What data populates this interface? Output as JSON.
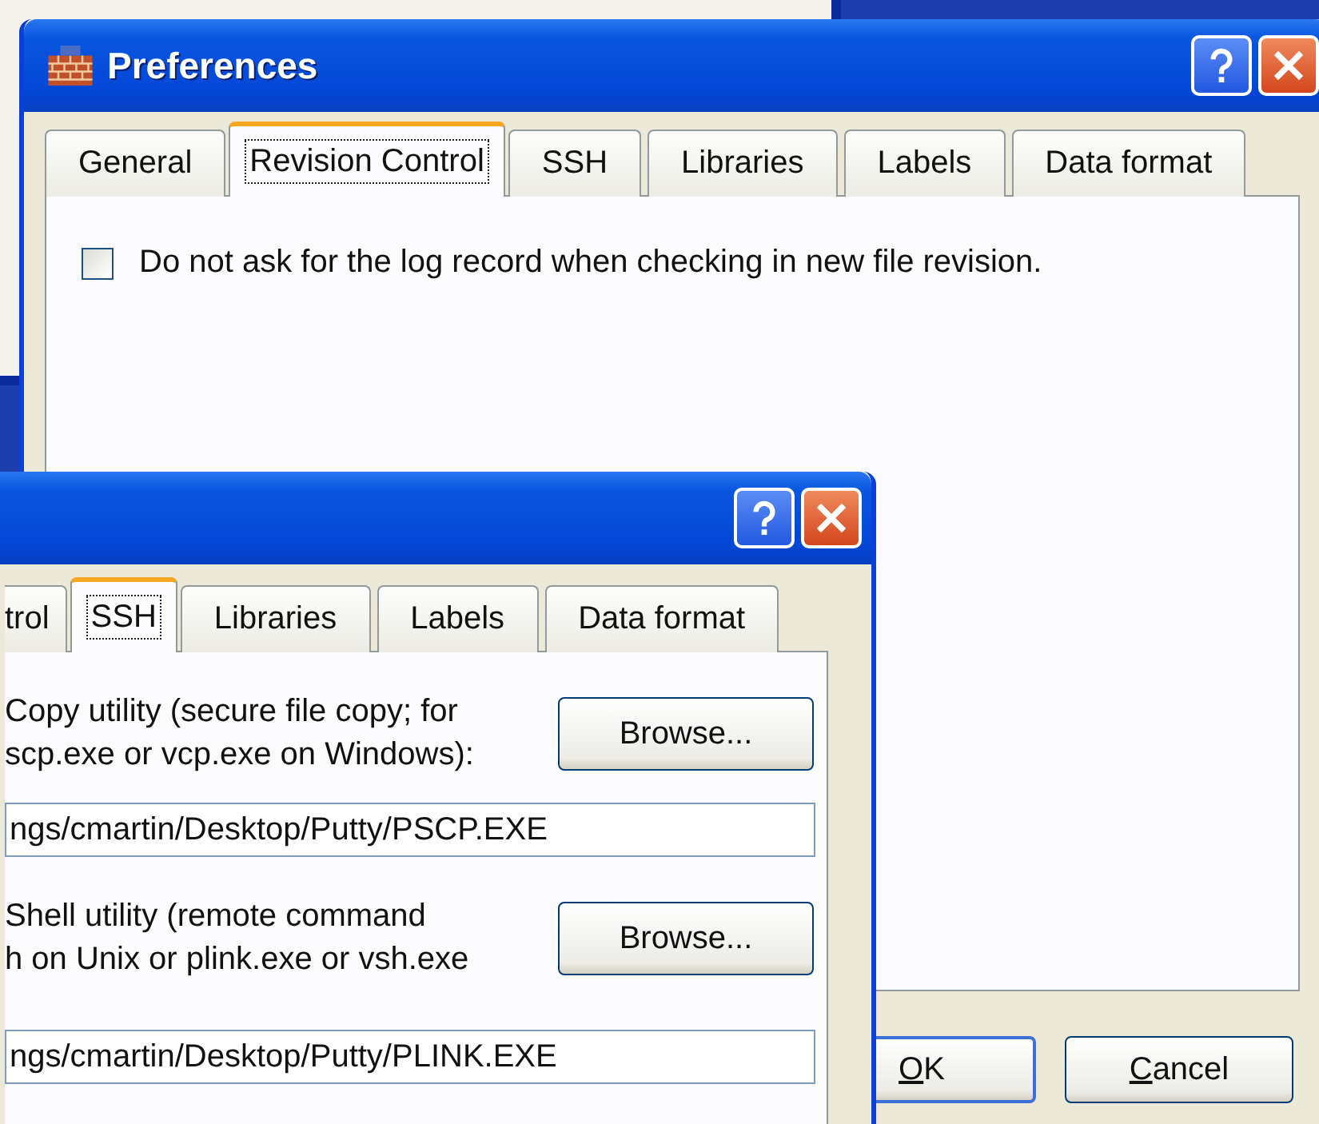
{
  "back_window": {
    "title": "Preferences",
    "tabs": [
      {
        "label": "General",
        "selected": false
      },
      {
        "label": "Revision Control",
        "selected": true
      },
      {
        "label": "SSH",
        "selected": false
      },
      {
        "label": "Libraries",
        "selected": false
      },
      {
        "label": "Labels",
        "selected": false
      },
      {
        "label": "Data format",
        "selected": false
      }
    ],
    "checkbox": {
      "label": "Do not ask for the log record when checking in new file revision.",
      "checked": false
    },
    "buttons": [
      {
        "label": "OK",
        "kind": "default"
      },
      {
        "label": "Cancel",
        "kind": "normal"
      }
    ]
  },
  "front_window": {
    "tabs": [
      {
        "label": "trol",
        "selected": false
      },
      {
        "label": "SSH",
        "selected": true
      },
      {
        "label": "Libraries",
        "selected": false
      },
      {
        "label": "Labels",
        "selected": false
      },
      {
        "label": "Data format",
        "selected": false
      }
    ],
    "settings": [
      {
        "label": "Copy utility (secure file copy; for\nscp.exe or vcp.exe on Windows):",
        "button": "Browse...",
        "value": "ngs/cmartin/Desktop/Putty/PSCP.EXE"
      },
      {
        "label": "Shell utility (remote command\nh on Unix or plink.exe or vsh.exe",
        "button": "Browse...",
        "value": "ngs/cmartin/Desktop/Putty/PLINK.EXE"
      }
    ]
  }
}
